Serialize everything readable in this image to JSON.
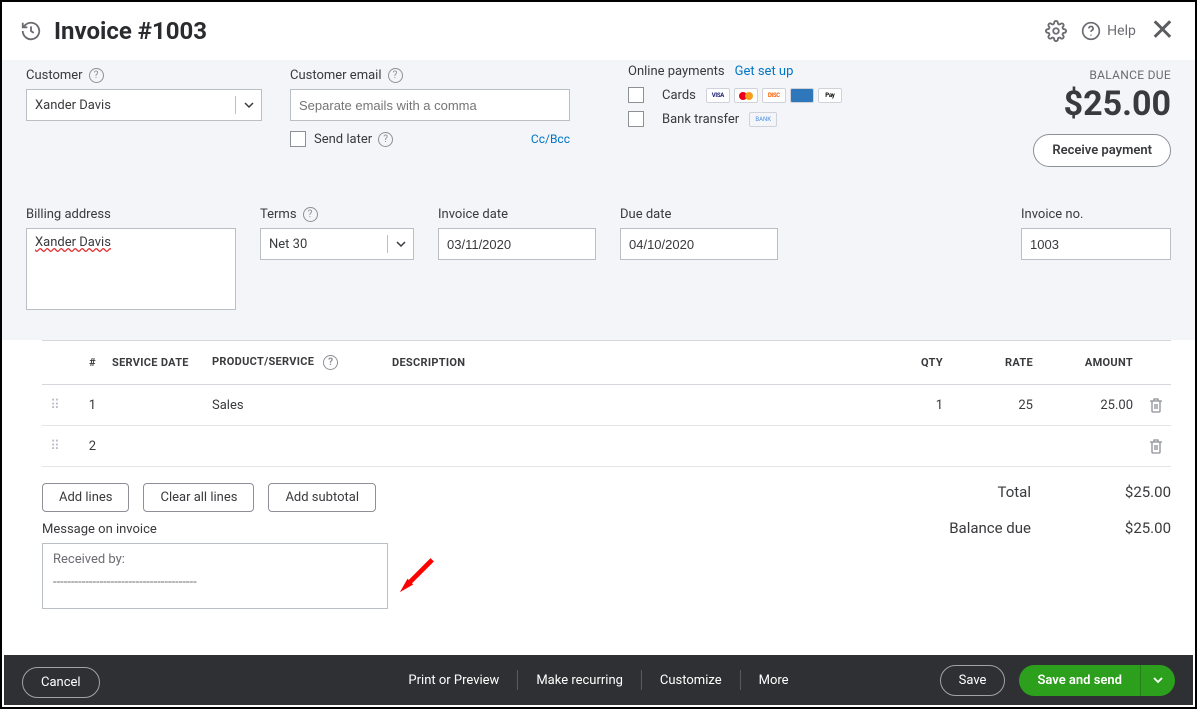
{
  "header": {
    "title": "Invoice #1003",
    "help_label": "Help"
  },
  "customer": {
    "label": "Customer",
    "value": "Xander Davis"
  },
  "email": {
    "label": "Customer email",
    "placeholder": "Separate emails with a comma",
    "send_later_label": "Send later",
    "ccbcc_label": "Cc/Bcc"
  },
  "online_payments": {
    "title": "Online payments",
    "setup_link": "Get set up",
    "cards_label": "Cards",
    "bank_label": "Bank transfer"
  },
  "balance": {
    "label": "BALANCE DUE",
    "amount": "$25.00",
    "receive_btn": "Receive payment"
  },
  "billing": {
    "label": "Billing address",
    "value": "Xander Davis"
  },
  "terms": {
    "label": "Terms",
    "value": "Net 30"
  },
  "invoice_date": {
    "label": "Invoice date",
    "value": "03/11/2020"
  },
  "due_date": {
    "label": "Due date",
    "value": "04/10/2020"
  },
  "invoice_no": {
    "label": "Invoice no.",
    "value": "1003"
  },
  "table": {
    "headers": {
      "num": "#",
      "service_date": "SERVICE DATE",
      "product": "PRODUCT/SERVICE",
      "description": "DESCRIPTION",
      "qty": "QTY",
      "rate": "RATE",
      "amount": "AMOUNT"
    },
    "rows": [
      {
        "num": "1",
        "service_date": "",
        "product": "Sales",
        "description": "",
        "qty": "1",
        "rate": "25",
        "amount": "25.00"
      },
      {
        "num": "2",
        "service_date": "",
        "product": "",
        "description": "",
        "qty": "",
        "rate": "",
        "amount": ""
      }
    ]
  },
  "buttons": {
    "add_lines": "Add lines",
    "clear_all": "Clear all lines",
    "add_subtotal": "Add subtotal"
  },
  "totals": {
    "total_label": "Total",
    "total_value": "$25.00",
    "balance_due_label": "Balance due",
    "balance_due_value": "$25.00"
  },
  "message": {
    "label": "Message on invoice",
    "line1": "Received by:",
    "line2": "----------------------------------------"
  },
  "footer": {
    "cancel": "Cancel",
    "print": "Print or Preview",
    "recurring": "Make recurring",
    "customize": "Customize",
    "more": "More",
    "save": "Save",
    "save_send": "Save and send"
  }
}
